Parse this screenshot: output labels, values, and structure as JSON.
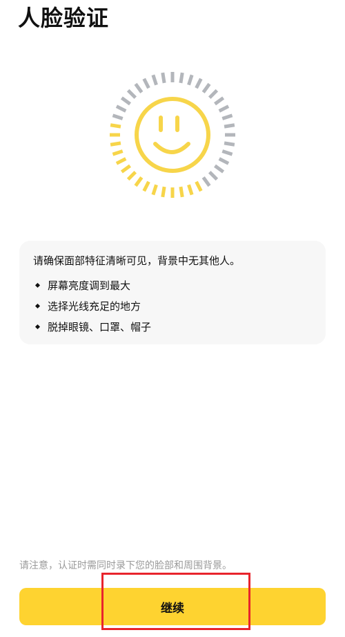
{
  "header": {
    "title": "人脸验证"
  },
  "face_graphic": {
    "icon": "smiley-face-icon",
    "face_color": "#f7d54a",
    "inactive_tick_color": "#b3b6bb",
    "active_tick_color": "#f7d54a"
  },
  "tips": {
    "heading": "请确保面部特征清晰可见，背景中无其他人。",
    "items": [
      {
        "label": "屏幕亮度调到最大"
      },
      {
        "label": "选择光线充足的地方"
      },
      {
        "label": "脱掉眼镜、口罩、帽子"
      }
    ]
  },
  "footer": {
    "notice": "请注意，认证时需同时录下您的脸部和周围背景。",
    "continue_label": "继续",
    "button_color": "#fed330",
    "highlight_color": "#e8242c"
  }
}
